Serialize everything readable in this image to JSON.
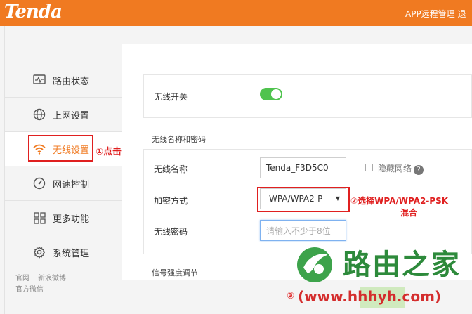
{
  "header": {
    "brand": "Tenda",
    "app_remote": "APP远程管理  退"
  },
  "sidebar": {
    "items": [
      {
        "label": "路由状态",
        "icon": "monitor-pulse-icon"
      },
      {
        "label": "上网设置",
        "icon": "globe-icon"
      },
      {
        "label": "无线设置",
        "icon": "wifi-icon"
      },
      {
        "label": "网速控制",
        "icon": "speed-gauge-icon"
      },
      {
        "label": "更多功能",
        "icon": "grid-icon"
      },
      {
        "label": "系统管理",
        "icon": "gear-icon"
      }
    ],
    "footer": {
      "official_site": "官网",
      "weibo": "新浪微博",
      "wechat": "官方微信"
    }
  },
  "annotations": {
    "step1": "①点击",
    "step2_line1": "②选择WPA/WPA2-PSK",
    "step2_line2": "混合",
    "step3_num": "③"
  },
  "wireless": {
    "switch_label": "无线开关",
    "switch_on": true,
    "section_ssid_title": "无线名称和密码",
    "ssid_label": "无线名称",
    "ssid_value": "Tenda_F3D5C0",
    "hide_network_label": "隐藏网络",
    "encryption_label": "加密方式",
    "encryption_value": "WPA/WPA2-P",
    "password_label": "无线密码",
    "password_placeholder": "请输入不少于8位",
    "section_signal_title": "信号强度调节"
  },
  "watermark": {
    "name": "路由之家",
    "url": "(www.hhhyh.com)"
  },
  "colors": {
    "brand_orange": "#f07a21",
    "toggle_green": "#4fc34e",
    "annotation_red": "#e02020",
    "watermark_green": "#2d8a3b"
  }
}
